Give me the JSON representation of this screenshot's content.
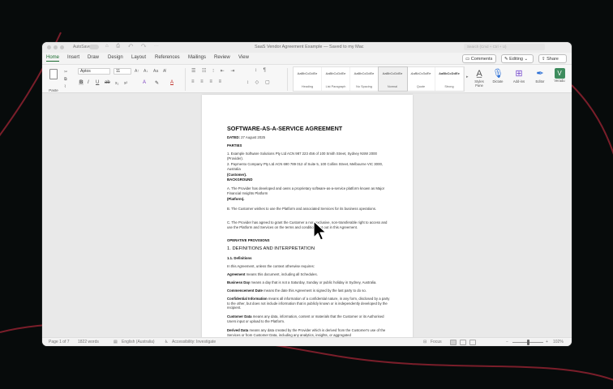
{
  "window": {
    "autosave_label": "AutoSave",
    "title": "SaaS Vendor Agreement Example — Saved to my Mac",
    "search_placeholder": "Search (Cmd + Ctrl + U)"
  },
  "ribbon_tabs": [
    "Home",
    "Insert",
    "Draw",
    "Design",
    "Layout",
    "References",
    "Mailings",
    "Review",
    "View"
  ],
  "header_buttons": {
    "comments": "Comments",
    "editing": "Editing",
    "share": "Share"
  },
  "ribbon": {
    "paste_label": "Paste",
    "font_name": "Aptos",
    "font_size": "11",
    "styles": [
      {
        "sample": "AaBbCcDdEe",
        "name": "Heading"
      },
      {
        "sample": "AaBbCcDdEe",
        "name": "List Paragraph"
      },
      {
        "sample": "AaBbCcDdEe",
        "name": "No Spacing"
      },
      {
        "sample": "AaBbCcDdEe",
        "name": "Normal"
      },
      {
        "sample": "AaBbCcDdEe",
        "name": "Quote"
      },
      {
        "sample": "AaBbCcDdEe",
        "name": "Strong"
      }
    ],
    "tools": [
      {
        "label": "Styles Pane",
        "icon": "styles-pane-icon"
      },
      {
        "label": "Dictate",
        "icon": "microphone-icon"
      },
      {
        "label": "Add-ins",
        "icon": "add-ins-icon"
      },
      {
        "label": "Editor",
        "icon": "editor-icon"
      },
      {
        "label": "Veradu",
        "icon": "veradu-icon"
      }
    ]
  },
  "document": {
    "title": "SOFTWARE-AS-A-SERVICE AGREEMENT",
    "date_label": "DATED:",
    "date_value": "27 August 2025",
    "parties_heading": "PARTIES",
    "party_1": "1. Example Software Solutions Pty Ltd ACN 987 223 456 of 100 Smith Street, Sydney NSW 2000 (Provider).",
    "party_2": "2. Paymento Company Pty Ltd ACN 690 789 012 of Suite 5, 100 Collins Street, Melbourne VIC 3000, Australia",
    "customer_line": "(Customer).",
    "background_heading": "BACKGROUND",
    "bg_a": "A. The Provider has developed and owns a proprietary software-as-a-service platform known as Major Financial Insights Platform",
    "platform_line": "(Platform).",
    "bg_b": "B. The Customer wishes to use the Platform and associated Services for its business operations.",
    "bg_c": "C. The Provider has agreed to grant the Customer a non-exclusive, non-transferable right to access and use the Platform and Services on the terms and conditions set out in this Agreement.",
    "operative_heading": "OPERATIVE PROVISIONS",
    "section_1": "1. DEFINITIONS AND INTERPRETATION",
    "section_1_1": "1.1. Definitions",
    "intro": "In this Agreement, unless the context otherwise requires:",
    "definitions": [
      {
        "term": "Agreement",
        "text": "means this document, including all Schedules."
      },
      {
        "term": "Business Day",
        "text": "means a day that is not a Saturday, Sunday or public holiday in Sydney, Australia."
      },
      {
        "term": "Commencement Date",
        "text": "means the date this Agreement is signed by the last party to do so."
      },
      {
        "term": "Confidential Information",
        "text": "means all information of a confidential nature, in any form, disclosed by a party to the other, but does not include information that is publicly known or is independently developed by the recipient."
      },
      {
        "term": "Customer Data",
        "text": "means any data, information, content or materials that the Customer or its Authorised Users input or upload to the Platform."
      },
      {
        "term": "Derived Data",
        "text": "means any data created by the Provider which is derived from the Customer's use of the Services or from Customer Data, including any analytics, insights, or aggregated"
      }
    ]
  },
  "status": {
    "page": "Page 1 of 7",
    "words": "1822 words",
    "language": "English (Australia)",
    "accessibility": "Accessibility: Investigate",
    "focus": "Focus",
    "zoom": "102%"
  }
}
